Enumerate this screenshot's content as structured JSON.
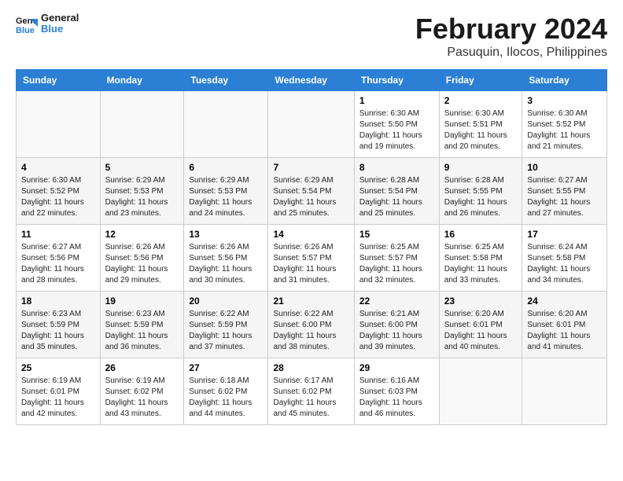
{
  "logo": {
    "text_general": "General",
    "text_blue": "Blue"
  },
  "header": {
    "month": "February 2024",
    "location": "Pasuquin, Ilocos, Philippines"
  },
  "days_of_week": [
    "Sunday",
    "Monday",
    "Tuesday",
    "Wednesday",
    "Thursday",
    "Friday",
    "Saturday"
  ],
  "weeks": [
    [
      {
        "day": "",
        "info": ""
      },
      {
        "day": "",
        "info": ""
      },
      {
        "day": "",
        "info": ""
      },
      {
        "day": "",
        "info": ""
      },
      {
        "day": "1",
        "info": "Sunrise: 6:30 AM\nSunset: 5:50 PM\nDaylight: 11 hours and 19 minutes."
      },
      {
        "day": "2",
        "info": "Sunrise: 6:30 AM\nSunset: 5:51 PM\nDaylight: 11 hours and 20 minutes."
      },
      {
        "day": "3",
        "info": "Sunrise: 6:30 AM\nSunset: 5:52 PM\nDaylight: 11 hours and 21 minutes."
      }
    ],
    [
      {
        "day": "4",
        "info": "Sunrise: 6:30 AM\nSunset: 5:52 PM\nDaylight: 11 hours and 22 minutes."
      },
      {
        "day": "5",
        "info": "Sunrise: 6:29 AM\nSunset: 5:53 PM\nDaylight: 11 hours and 23 minutes."
      },
      {
        "day": "6",
        "info": "Sunrise: 6:29 AM\nSunset: 5:53 PM\nDaylight: 11 hours and 24 minutes."
      },
      {
        "day": "7",
        "info": "Sunrise: 6:29 AM\nSunset: 5:54 PM\nDaylight: 11 hours and 25 minutes."
      },
      {
        "day": "8",
        "info": "Sunrise: 6:28 AM\nSunset: 5:54 PM\nDaylight: 11 hours and 25 minutes."
      },
      {
        "day": "9",
        "info": "Sunrise: 6:28 AM\nSunset: 5:55 PM\nDaylight: 11 hours and 26 minutes."
      },
      {
        "day": "10",
        "info": "Sunrise: 6:27 AM\nSunset: 5:55 PM\nDaylight: 11 hours and 27 minutes."
      }
    ],
    [
      {
        "day": "11",
        "info": "Sunrise: 6:27 AM\nSunset: 5:56 PM\nDaylight: 11 hours and 28 minutes."
      },
      {
        "day": "12",
        "info": "Sunrise: 6:26 AM\nSunset: 5:56 PM\nDaylight: 11 hours and 29 minutes."
      },
      {
        "day": "13",
        "info": "Sunrise: 6:26 AM\nSunset: 5:56 PM\nDaylight: 11 hours and 30 minutes."
      },
      {
        "day": "14",
        "info": "Sunrise: 6:26 AM\nSunset: 5:57 PM\nDaylight: 11 hours and 31 minutes."
      },
      {
        "day": "15",
        "info": "Sunrise: 6:25 AM\nSunset: 5:57 PM\nDaylight: 11 hours and 32 minutes."
      },
      {
        "day": "16",
        "info": "Sunrise: 6:25 AM\nSunset: 5:58 PM\nDaylight: 11 hours and 33 minutes."
      },
      {
        "day": "17",
        "info": "Sunrise: 6:24 AM\nSunset: 5:58 PM\nDaylight: 11 hours and 34 minutes."
      }
    ],
    [
      {
        "day": "18",
        "info": "Sunrise: 6:23 AM\nSunset: 5:59 PM\nDaylight: 11 hours and 35 minutes."
      },
      {
        "day": "19",
        "info": "Sunrise: 6:23 AM\nSunset: 5:59 PM\nDaylight: 11 hours and 36 minutes."
      },
      {
        "day": "20",
        "info": "Sunrise: 6:22 AM\nSunset: 5:59 PM\nDaylight: 11 hours and 37 minutes."
      },
      {
        "day": "21",
        "info": "Sunrise: 6:22 AM\nSunset: 6:00 PM\nDaylight: 11 hours and 38 minutes."
      },
      {
        "day": "22",
        "info": "Sunrise: 6:21 AM\nSunset: 6:00 PM\nDaylight: 11 hours and 39 minutes."
      },
      {
        "day": "23",
        "info": "Sunrise: 6:20 AM\nSunset: 6:01 PM\nDaylight: 11 hours and 40 minutes."
      },
      {
        "day": "24",
        "info": "Sunrise: 6:20 AM\nSunset: 6:01 PM\nDaylight: 11 hours and 41 minutes."
      }
    ],
    [
      {
        "day": "25",
        "info": "Sunrise: 6:19 AM\nSunset: 6:01 PM\nDaylight: 11 hours and 42 minutes."
      },
      {
        "day": "26",
        "info": "Sunrise: 6:19 AM\nSunset: 6:02 PM\nDaylight: 11 hours and 43 minutes."
      },
      {
        "day": "27",
        "info": "Sunrise: 6:18 AM\nSunset: 6:02 PM\nDaylight: 11 hours and 44 minutes."
      },
      {
        "day": "28",
        "info": "Sunrise: 6:17 AM\nSunset: 6:02 PM\nDaylight: 11 hours and 45 minutes."
      },
      {
        "day": "29",
        "info": "Sunrise: 6:16 AM\nSunset: 6:03 PM\nDaylight: 11 hours and 46 minutes."
      },
      {
        "day": "",
        "info": ""
      },
      {
        "day": "",
        "info": ""
      }
    ]
  ]
}
